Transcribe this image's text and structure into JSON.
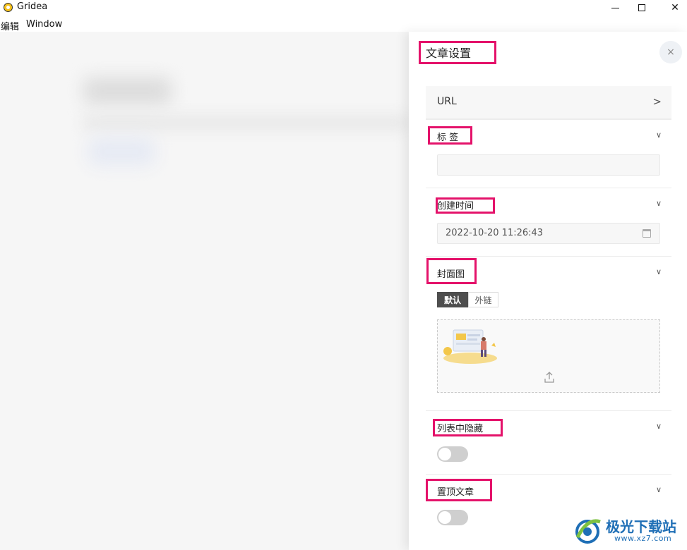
{
  "window": {
    "title": "Gridea",
    "minimize": "─",
    "maximize": "☐",
    "close": "✕"
  },
  "menu": {
    "edit": "编辑",
    "window": "Window"
  },
  "panel": {
    "title": "文章设置",
    "close_icon": "×",
    "url": {
      "label": "URL",
      "arrow": ">"
    },
    "tags": {
      "label": "标 签",
      "value": ""
    },
    "created_time": {
      "label": "创建时间",
      "value": "2022-10-20 11:26:43"
    },
    "cover": {
      "label": "封面图",
      "tabs": [
        "默认",
        "外链"
      ],
      "selected_tab": "默认"
    },
    "hide_in_list": {
      "label": "列表中隐藏",
      "enabled": false
    },
    "pin_article": {
      "label": "置顶文章",
      "enabled": false
    },
    "chevron": "∨"
  },
  "watermark": {
    "text": "极光下载站",
    "url": "www.xz7.com"
  },
  "colors": {
    "highlight": "#e4126a",
    "toggle_off": "#cfcfcf",
    "segment_active": "#4e4e4e",
    "watermark": "#1f6fb6"
  }
}
